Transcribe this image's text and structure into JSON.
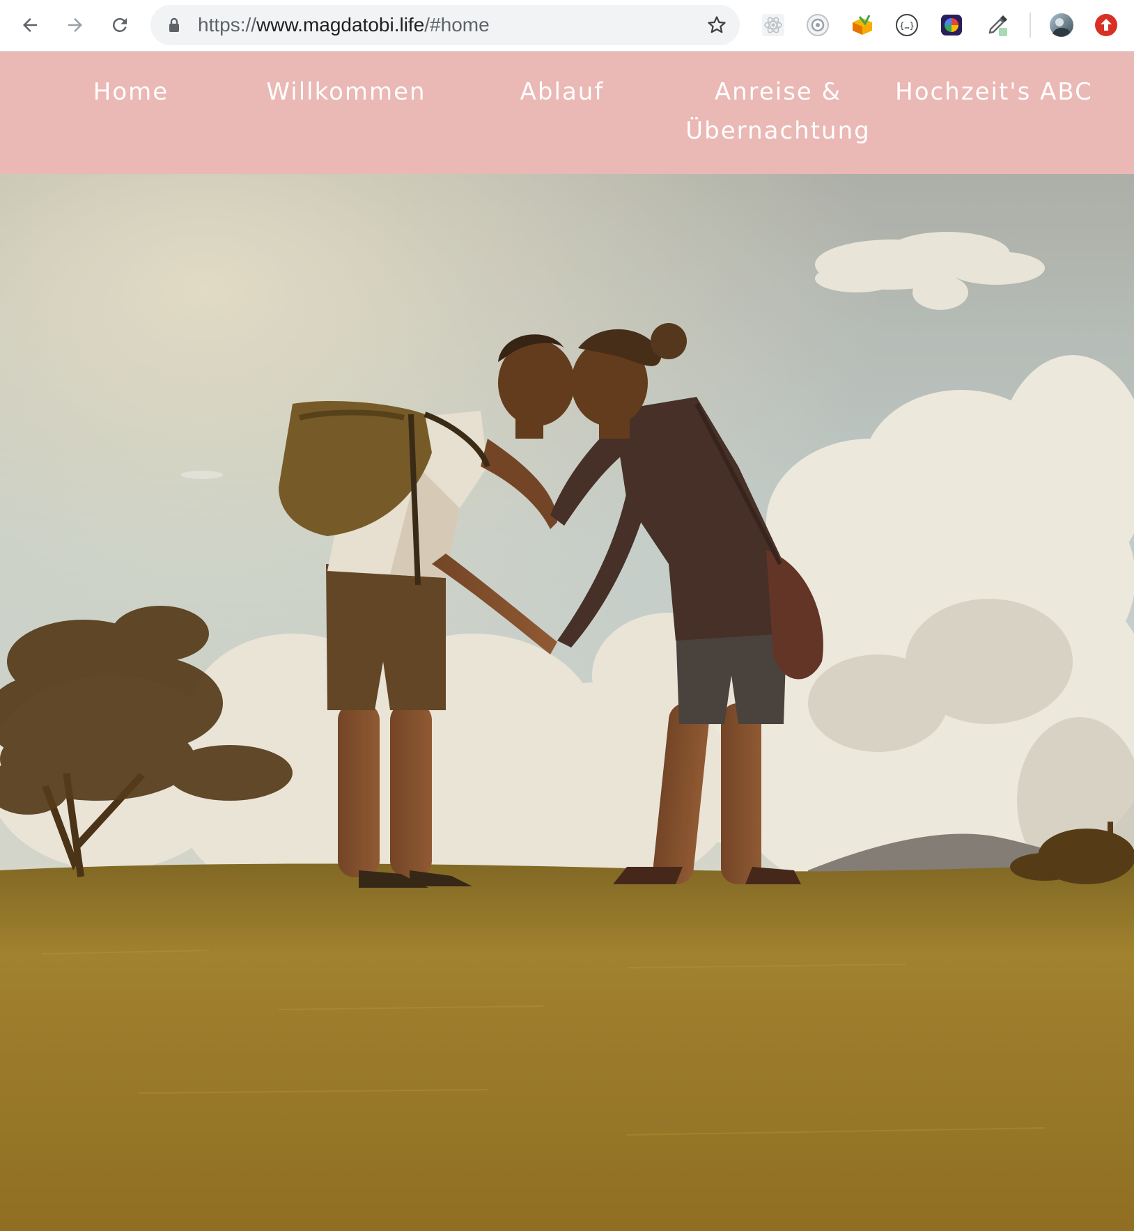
{
  "browser": {
    "url_scheme": "https://",
    "url_host": "www.magdatobi.life",
    "url_path": "/#home",
    "icons": {
      "back": "arrow-left-icon",
      "forward": "arrow-right-icon",
      "reload": "reload-icon",
      "lock": "lock-icon",
      "bookmark": "star-icon",
      "extensions": [
        "react-devtools-icon",
        "camera-extension-icon",
        "box-extension-icon",
        "json-formatter-icon",
        "colorful-extension-icon",
        "eyedropper-icon"
      ],
      "profile": "avatar",
      "update": "update-arrow-icon"
    }
  },
  "site_nav": {
    "items": [
      {
        "label": "Home"
      },
      {
        "label": "Willkommen"
      },
      {
        "label": "Ablauf"
      },
      {
        "label_line1": "Anreise &",
        "label_line2": "Übernachtung"
      },
      {
        "label": "Hochzeit's ABC"
      }
    ],
    "background": "#eab8b5",
    "text_color": "#ffffff"
  },
  "hero": {
    "image": "couple-kissing-photo"
  }
}
